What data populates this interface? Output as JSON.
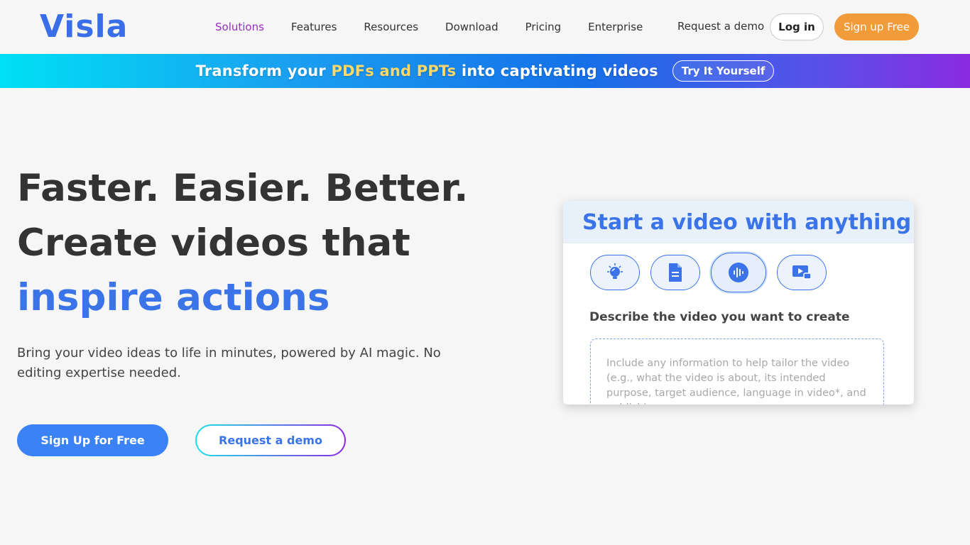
{
  "header": {
    "logo": "Visla",
    "nav": [
      "Solutions",
      "Features",
      "Resources",
      "Download",
      "Pricing",
      "Enterprise"
    ],
    "request_demo": "Request a demo",
    "login": "Log in",
    "signup": "Sign up Free"
  },
  "banner": {
    "text_before": "Transform your ",
    "highlight": "PDFs and PPTs",
    "text_after": " into captivating videos",
    "button": "Try It Yourself"
  },
  "hero": {
    "line1": "Faster. Easier. Better.",
    "line2": "Create videos that",
    "line3": "inspire actions",
    "subtext": "Bring your video ideas to life in minutes, powered by AI magic. No editing expertise needed.",
    "cta_primary": "Sign Up for Free",
    "cta_secondary": "Request a demo"
  },
  "card": {
    "title": "Start a video with anything",
    "icons": [
      "lightbulb-icon",
      "document-icon",
      "audio-icon",
      "screen-record-icon"
    ],
    "label": "Describe the video you want to create",
    "placeholder": "Include any information to help tailor the video (e.g., what the video is about,  its intended purpose, target audience, language in video*, and publishing"
  },
  "colors": {
    "brand_blue": "#3a74e8",
    "accent_orange": "#f29b3a",
    "nav_active": "#9b2cc4",
    "banner_highlight": "#ffd86a"
  }
}
